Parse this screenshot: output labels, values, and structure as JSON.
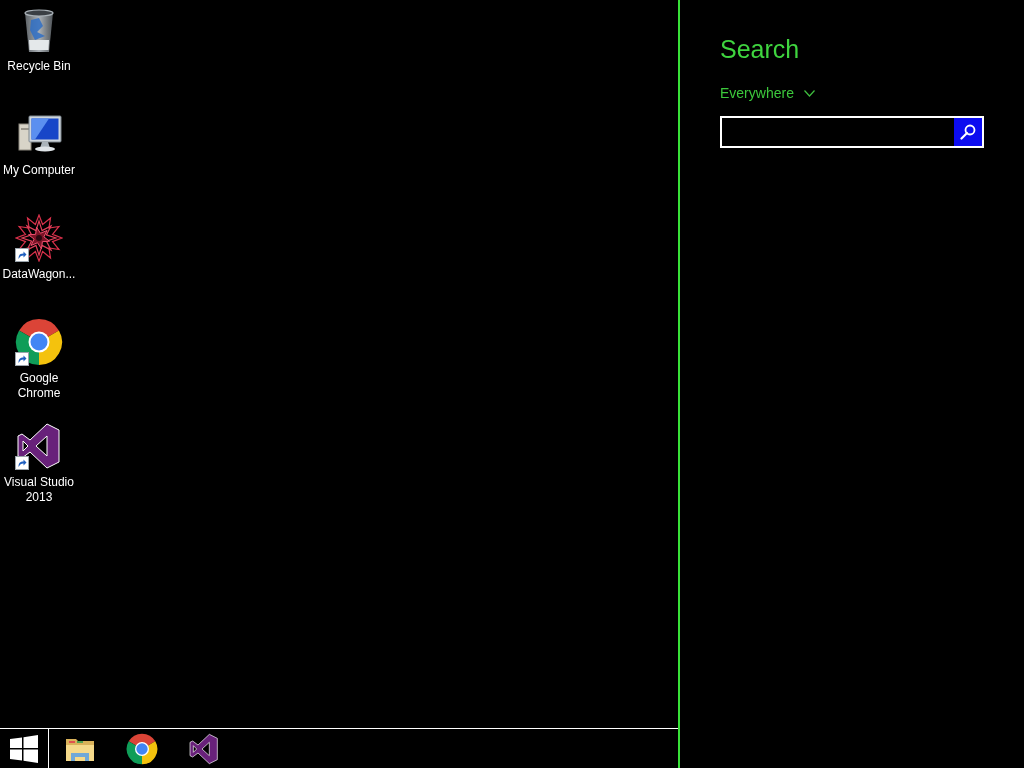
{
  "desktop": {
    "icons": [
      {
        "kind": "bin",
        "label": "Recycle Bin",
        "shortcut": false
      },
      {
        "kind": "computer",
        "label": "My Computer",
        "shortcut": false
      },
      {
        "kind": "star",
        "label": "DataWagon...",
        "shortcut": true
      },
      {
        "kind": "browser",
        "label": "Google Chrome",
        "shortcut": true
      },
      {
        "kind": "ide",
        "label": "Visual Studio 2013",
        "shortcut": true
      }
    ]
  },
  "taskbar": {
    "pinned": [
      {
        "kind": "folder"
      },
      {
        "kind": "browser"
      },
      {
        "kind": "ide"
      }
    ]
  },
  "search_pane": {
    "title": "Search",
    "scope": "Everywhere"
  }
}
